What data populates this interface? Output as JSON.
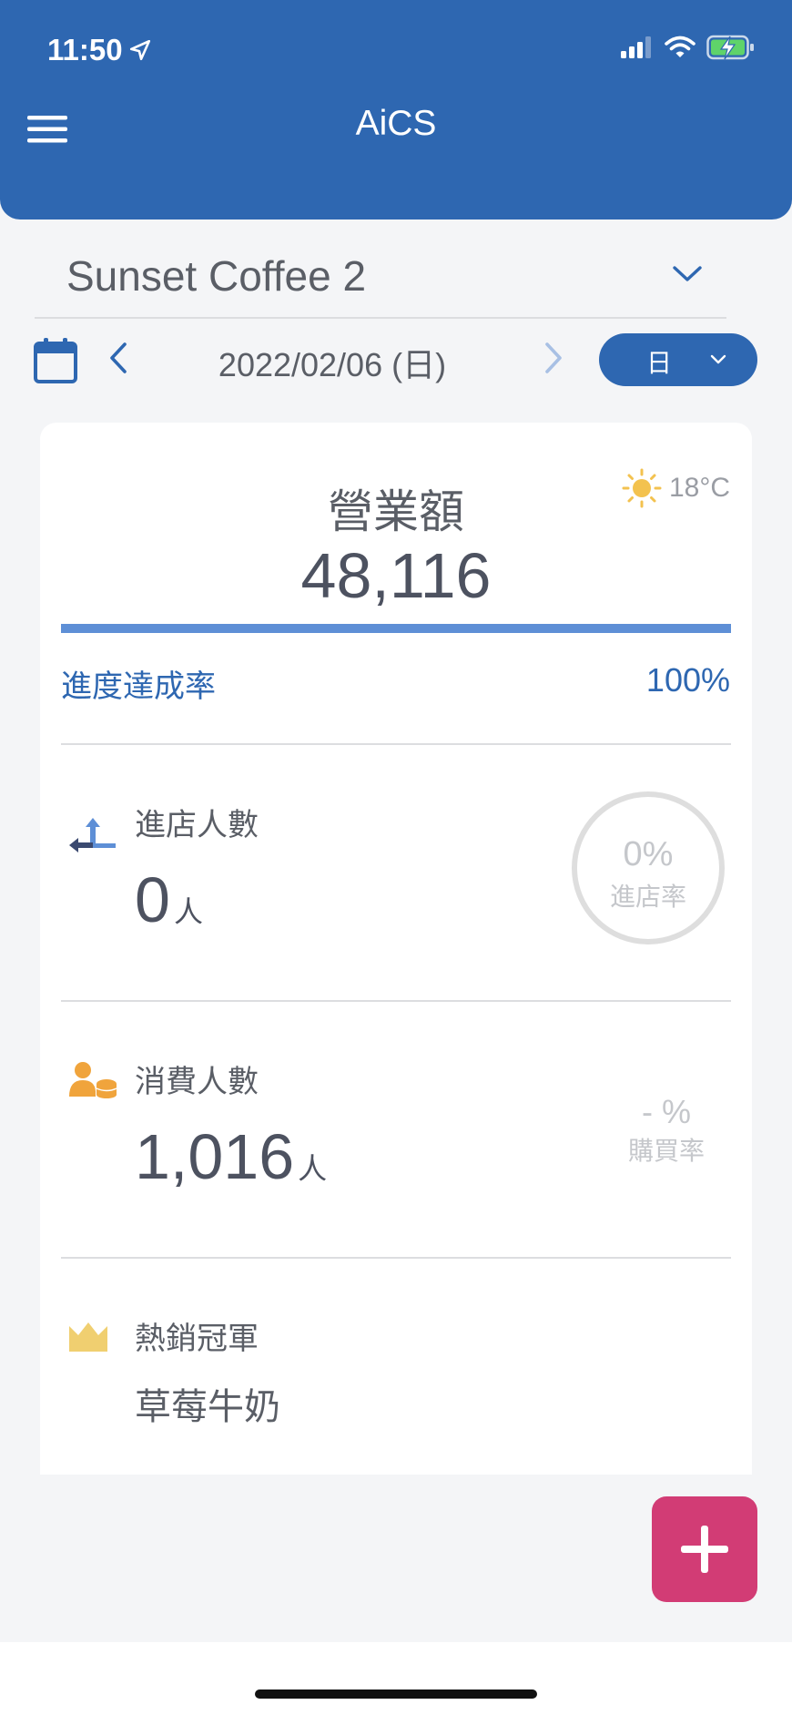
{
  "status_bar": {
    "time": "11:50"
  },
  "header": {
    "title": "AiCS"
  },
  "store": {
    "name": "Sunset Coffee 2"
  },
  "date_nav": {
    "date": "2022/02/06 (日)",
    "period": "日"
  },
  "summary": {
    "weather_temp": "18°C",
    "sales_label": "營業額",
    "sales_value": "48,116",
    "progress_label": "進度達成率",
    "progress_pct": "100%",
    "progress_fraction": 1.0
  },
  "visitors": {
    "label": "進店人數",
    "value": "0",
    "unit": "人",
    "rate_pct": "0%",
    "rate_label": "進店率"
  },
  "buyers": {
    "label": "消費人數",
    "value": "1,016",
    "unit": "人",
    "rate_pct": "- %",
    "rate_label": "購買率"
  },
  "best_seller": {
    "label": "熱銷冠軍",
    "product": "草莓牛奶"
  },
  "colors": {
    "primary": "#2e67b1",
    "progress": "#5e8fd6",
    "fab": "#d23c75",
    "buyers_icon": "#f0a43c",
    "crown": "#f0cf70",
    "sun": "#f3c24f"
  },
  "icons": [
    "location-arrow-icon",
    "signal-icon",
    "wifi-icon",
    "battery-charging-icon",
    "menu-icon",
    "chevron-down-icon",
    "calendar-icon",
    "chevron-left-icon",
    "chevron-right-icon",
    "sun-icon",
    "entry-arrow-icon",
    "buyers-coins-icon",
    "crown-icon",
    "plus-icon"
  ]
}
